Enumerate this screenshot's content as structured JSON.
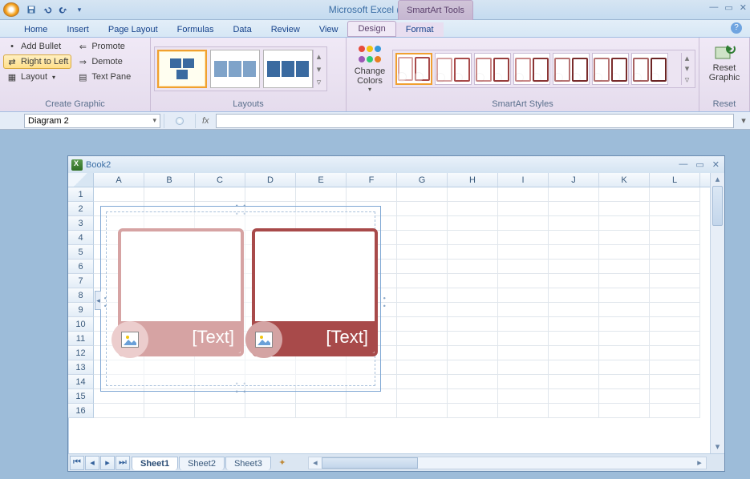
{
  "title": "Microsoft Excel (Trial)",
  "tool_context": "SmartArt Tools",
  "tabs": [
    "Home",
    "Insert",
    "Page Layout",
    "Formulas",
    "Data",
    "Review",
    "View",
    "Design",
    "Format"
  ],
  "active_tab": "Design",
  "ribbon": {
    "create_graphic": {
      "label": "Create Graphic",
      "add_bullet": "Add Bullet",
      "right_to_left": "Right to Left",
      "layout": "Layout",
      "promote": "Promote",
      "demote": "Demote",
      "text_pane": "Text Pane"
    },
    "layouts": {
      "label": "Layouts"
    },
    "change_colors": {
      "label": "Change Colors"
    },
    "styles": {
      "label": "SmartArt Styles"
    },
    "reset": {
      "label": "Reset",
      "btn": "Reset Graphic"
    }
  },
  "namebox": "Diagram 2",
  "fx_label": "fx",
  "workbook": {
    "title": "Book2",
    "columns": [
      "A",
      "B",
      "C",
      "D",
      "E",
      "F",
      "G",
      "H",
      "I",
      "J",
      "K",
      "L"
    ],
    "rows": 16,
    "sheets": [
      "Sheet1",
      "Sheet2",
      "Sheet3"
    ],
    "active_sheet": "Sheet1"
  },
  "smartart": {
    "shape1_text": "[Text]",
    "shape2_text": "[Text]"
  }
}
